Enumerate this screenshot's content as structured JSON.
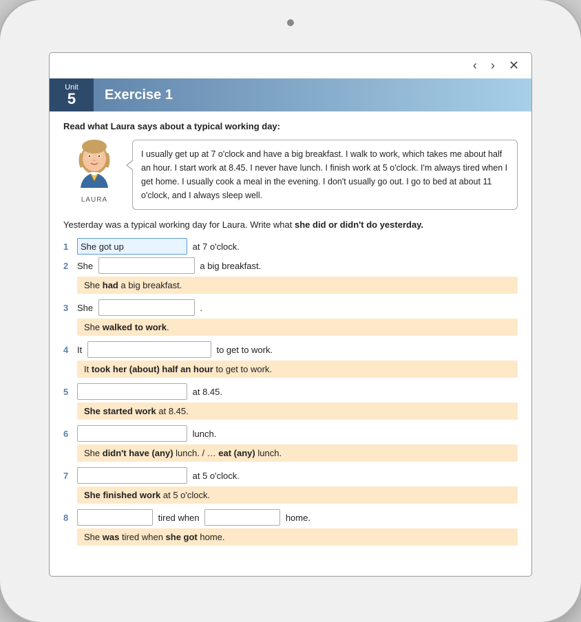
{
  "tablet": {
    "nav": {
      "prev_label": "‹",
      "next_label": "›",
      "close_label": "✕"
    },
    "header": {
      "unit_label": "Unit",
      "unit_number": "5",
      "exercise_title": "Exercise 1"
    },
    "content": {
      "instruction": "Read what Laura says about a typical working day:",
      "laura_name": "LAURA",
      "speech_text": "I usually get up at 7 o'clock and have a big breakfast.  I walk to work, which takes me about half an hour.  I start work at 8.45.  I never have lunch.  I finish work at 5 o'clock.  I'm always tired when I get home.  I usually cook a meal in the evening.  I don't usually go out.  I go to bed at about 11 o'clock, and I always sleep well.",
      "task_instruction_plain": "Yesterday was a typical working day for Laura.  Write what ",
      "task_instruction_bold": "she did or didn't do yesterday.",
      "exercises": [
        {
          "number": "1",
          "prefilled": "She got up",
          "before": "",
          "after": "at 7 o'clock.",
          "input_width": 160,
          "answer": "",
          "answer_html": ""
        },
        {
          "number": "2",
          "prefilled": "",
          "before": "She",
          "after": "a big breakfast.",
          "input_width": 140,
          "answer": "She had a big breakfast.",
          "answer_bold": "had"
        },
        {
          "number": "3",
          "prefilled": "",
          "before": "She",
          "after": ".",
          "input_width": 140,
          "answer": "She walked to work.",
          "answer_bold": "walked to work"
        },
        {
          "number": "4",
          "prefilled": "",
          "before": "It",
          "after": "to get to work.",
          "input_width": 180,
          "answer": "It took her (about) half an hour to get to work.",
          "answer_bold": "took her (about) half an hour"
        },
        {
          "number": "5",
          "prefilled": "",
          "before": "",
          "after": "at 8.45.",
          "input_width": 160,
          "answer": "She started work at 8.45.",
          "answer_bold": "She started work"
        },
        {
          "number": "6",
          "prefilled": "",
          "before": "",
          "after": "lunch.",
          "input_width": 160,
          "answer": "She didn't have (any) lunch. / … eat (any) lunch.",
          "answer_bold": "didn't have (any)"
        },
        {
          "number": "7",
          "prefilled": "",
          "before": "",
          "after": "at 5 o'clock.",
          "input_width": 160,
          "answer": "She finished work at 5 o'clock.",
          "answer_bold": "She finished work"
        },
        {
          "number": "8",
          "prefilled": "",
          "before": "",
          "after": "tired when",
          "input2_after": "home.",
          "input_width": 110,
          "input2_width": 110,
          "answer": "She was tired when she got home.",
          "answer_bold": "was",
          "answer_bold2": "she got"
        }
      ]
    }
  }
}
